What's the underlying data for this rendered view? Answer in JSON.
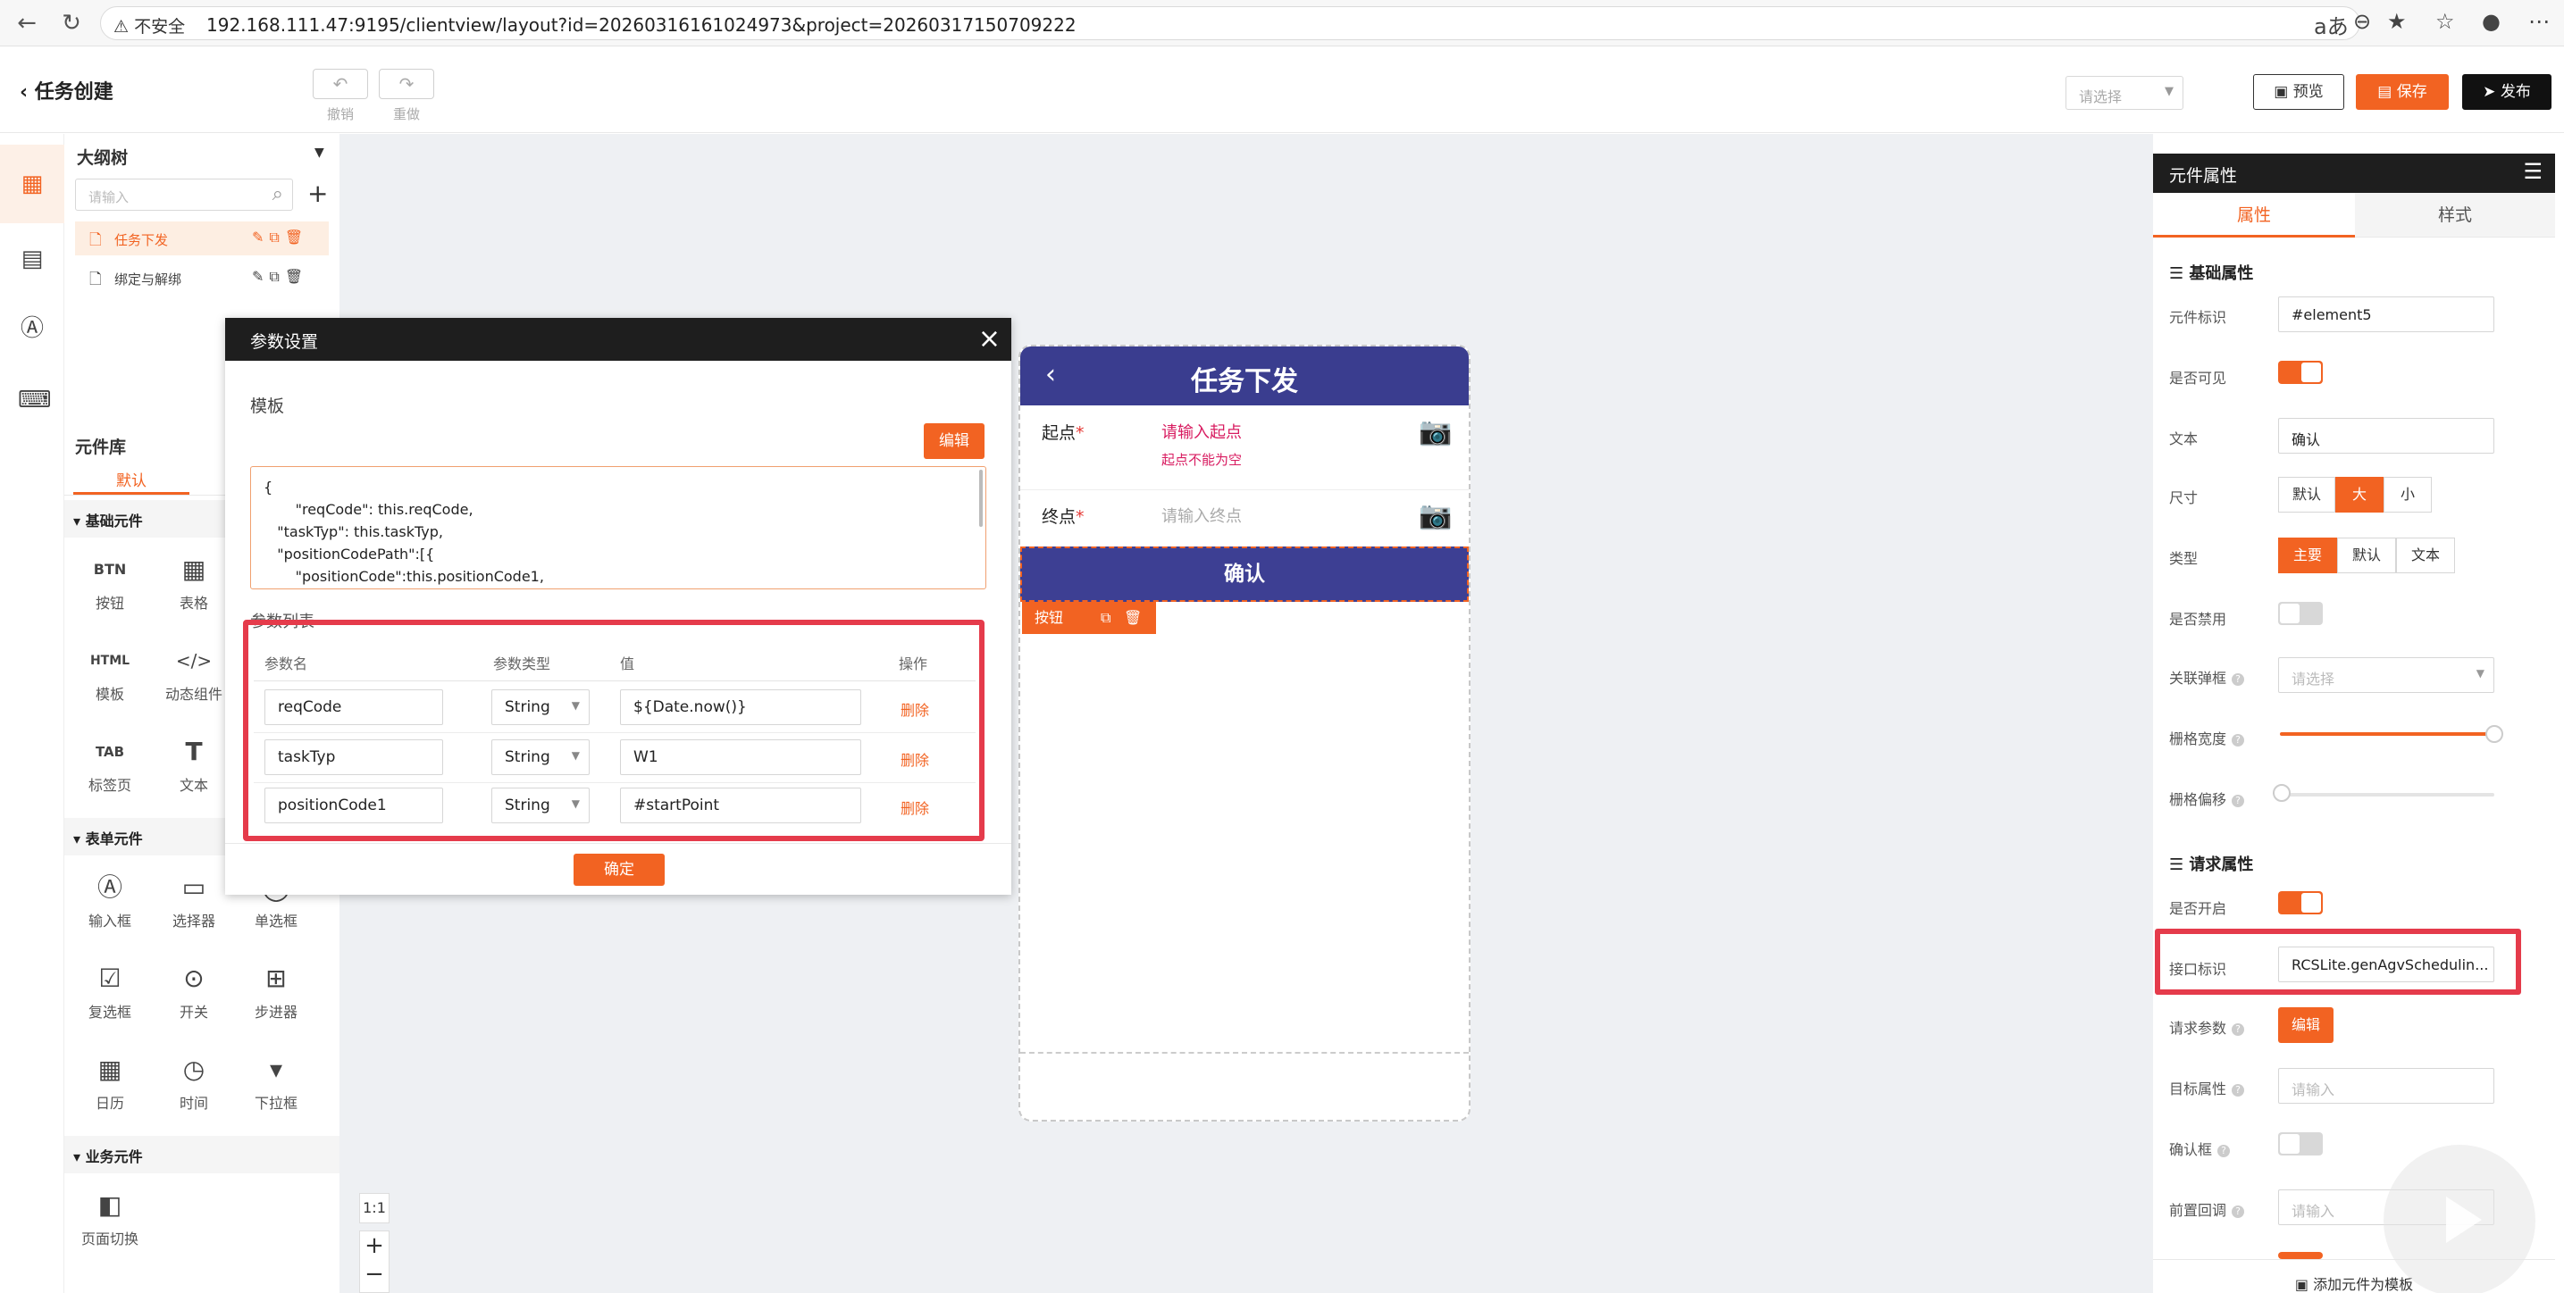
{
  "browser": {
    "insecure_label": "不安全",
    "url": "192.168.111.47:9195/clientview/layout?id=20260316161024973&project=20260317150709222"
  },
  "header": {
    "title": "任务创建",
    "undo_label": "撤销",
    "redo_label": "重做",
    "select_placeholder": "请选择",
    "preview_label": "预览",
    "save_label": "保存",
    "publish_label": "发布"
  },
  "outline": {
    "title": "大纲树",
    "search_placeholder": "请输入",
    "items": [
      {
        "label": "任务下发",
        "active": true
      },
      {
        "label": "绑定与解绑",
        "active": false
      }
    ]
  },
  "library": {
    "title": "元件库",
    "tab": "默认",
    "sections": [
      {
        "title": "基础元件",
        "items": [
          "按钮",
          "表格",
          "模板",
          "动态组件",
          "标签页",
          "文本"
        ],
        "icons": [
          "BTN",
          "table-icon",
          "HTML",
          "code-icon",
          "TAB",
          "T"
        ]
      },
      {
        "title": "表单元件",
        "items": [
          "输入框",
          "选择器",
          "单选框",
          "复选框",
          "开关",
          "步进器",
          "日历",
          "时间",
          "下拉框"
        ]
      },
      {
        "title": "业务元件",
        "items": [
          "页面切换"
        ]
      }
    ]
  },
  "canvas": {
    "zoom_label": "1:1",
    "phone": {
      "title": "任务下发",
      "fields": [
        {
          "label": "起点",
          "value": "请输入起点",
          "error": "起点不能为空"
        },
        {
          "label": "终点",
          "placeholder": "请输入终点"
        }
      ],
      "confirm_label": "确认",
      "tool_label": "按钮"
    }
  },
  "dialog": {
    "title": "参数设置",
    "template_label": "模板",
    "edit_label": "编辑",
    "code": "{\n       \"reqCode\": this.reqCode,\n   \"taskTyp\": this.taskTyp,\n   \"positionCodePath\":[{\n       \"positionCode\":this.positionCode1,",
    "list_label": "参数列表",
    "columns": [
      "参数名",
      "参数类型",
      "值",
      "操作"
    ],
    "rows": [
      {
        "name": "reqCode",
        "type": "String",
        "value": "${Date.now()}",
        "action": "删除"
      },
      {
        "name": "taskTyp",
        "type": "String",
        "value": "W1",
        "action": "删除"
      },
      {
        "name": "positionCode1",
        "type": "String",
        "value": "#startPoint",
        "action": "删除"
      }
    ],
    "ok_label": "确定"
  },
  "props": {
    "title": "元件属性",
    "tabs": [
      "属性",
      "样式"
    ],
    "basic_title": "基础属性",
    "id_label": "元件标识",
    "id_value": "#element5",
    "visible_label": "是否可见",
    "text_label": "文本",
    "text_value": "确认",
    "size_label": "尺寸",
    "size_options": [
      "默认",
      "大",
      "小"
    ],
    "type_label": "类型",
    "type_options": [
      "主要",
      "默认",
      "文本"
    ],
    "disabled_label": "是否禁用",
    "popup_label": "关联弹框",
    "popup_placeholder": "请选择",
    "grid_width_label": "栅格宽度",
    "grid_offset_label": "栅格偏移",
    "request_title": "请求属性",
    "enable_label": "是否开启",
    "iface_label": "接口标识",
    "iface_value": "RCSLite.genAgvSchedulin...",
    "req_params_label": "请求参数",
    "req_params_btn": "编辑",
    "target_label": "目标属性",
    "target_placeholder": "请输入",
    "confirm_box_label": "确认框",
    "pre_callback_label": "前置回调",
    "pre_callback_placeholder": "请输入",
    "bottom_label": "添加元件为模板"
  },
  "colors": {
    "accent": "#f26322",
    "header_dark": "#1e1e1e",
    "phone_primary": "#3a3d8f",
    "highlight": "#e53b4b"
  }
}
